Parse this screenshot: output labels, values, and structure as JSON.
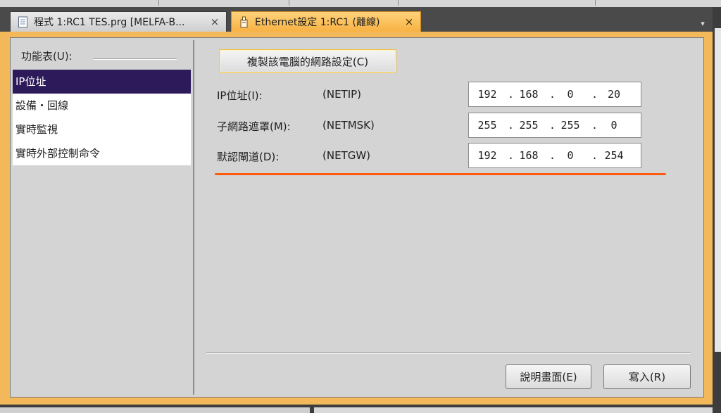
{
  "tabs": [
    {
      "label": "程式 1:RC1 TES.prg   [MELFA-B...",
      "close": "×",
      "icon": "document-icon",
      "active": false
    },
    {
      "label": "Ethernet設定 1:RC1 (離線)",
      "close": "×",
      "icon": "ethernet-settings-icon",
      "active": true
    }
  ],
  "tab_dropdown": "▾",
  "menu": {
    "header": "功能表(U):",
    "items": [
      {
        "label": "IP位址",
        "selected": true
      },
      {
        "label": "設備・回線",
        "selected": false
      },
      {
        "label": "實時監視",
        "selected": false
      },
      {
        "label": "實時外部控制命令",
        "selected": false
      }
    ]
  },
  "settings": {
    "copy_button": "複製該電腦的網路設定(C)",
    "rows": [
      {
        "label": "IP位址(I):",
        "param": "(NETIP)",
        "octets": [
          "192",
          "168",
          "0",
          "20"
        ]
      },
      {
        "label": "子網路遮罩(M):",
        "param": "(NETMSK)",
        "octets": [
          "255",
          "255",
          "255",
          "0"
        ]
      },
      {
        "label": "默認閘道(D):",
        "param": "(NETGW)",
        "octets": [
          "192",
          "168",
          "0",
          "254"
        ]
      }
    ],
    "dot": ".",
    "highlight_color": "#ff5a10"
  },
  "buttons": {
    "help": "說明畫面(E)",
    "write": "寫入(R)"
  },
  "colors": {
    "active_tab": "#f7b244",
    "frame": "#f2b85a",
    "menu_selected": "#2d1a5a"
  }
}
